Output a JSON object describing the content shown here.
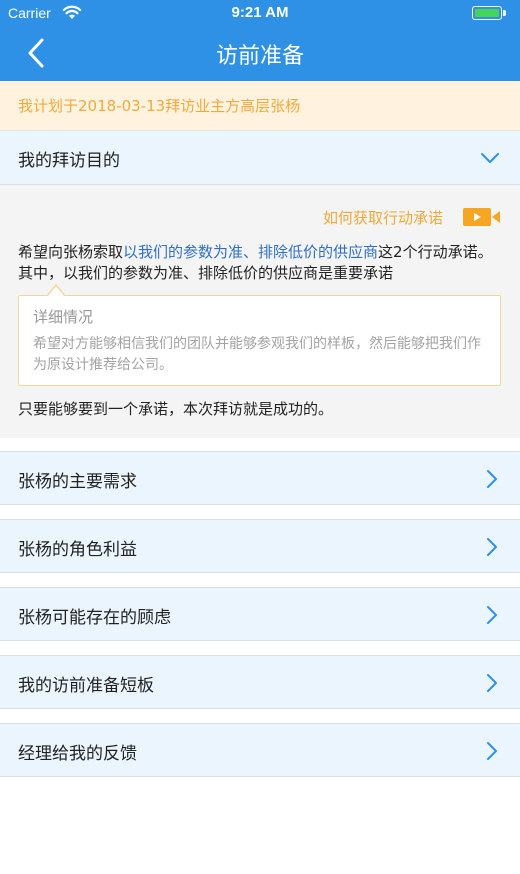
{
  "status": {
    "carrier": "Carrier",
    "time": "9:21 AM"
  },
  "nav": {
    "title": "访前准备"
  },
  "banner": {
    "text": "我计划于2018-03-13拜访业主方高层张杨"
  },
  "purpose": {
    "label": "我的拜访目的",
    "howto": "如何获取行动承诺",
    "para_1": "希望向张杨索取",
    "para_highlight": "以我们的参数为准、排除低价的供应商",
    "para_2": "这2个行动承诺。其中，以我们的参数为准、排除低价的供应商是重要承诺",
    "callout_title": "详细情况",
    "callout_body": "希望对方能够相信我们的团队并能够参观我们的样板，然后能够把我们作为原设计推荐给公司。",
    "result": "只要能够要到一个承诺，本次拜访就是成功的。"
  },
  "rows": [
    {
      "label": "张杨的主要需求"
    },
    {
      "label": "张杨的角色利益"
    },
    {
      "label": "张杨可能存在的顾虑"
    },
    {
      "label": "我的访前准备短板"
    },
    {
      "label": "经理给我的反馈"
    }
  ],
  "colors": {
    "brand_blue": "#2f91e6",
    "accent_orange": "#f2a93b",
    "link_blue": "#2f6fc5",
    "battery_green": "#45d35a"
  },
  "icons": [
    "wifi-icon",
    "battery-icon",
    "back-arrow-icon",
    "chevron-down-icon",
    "video-icon",
    "chevron-right-icon"
  ]
}
